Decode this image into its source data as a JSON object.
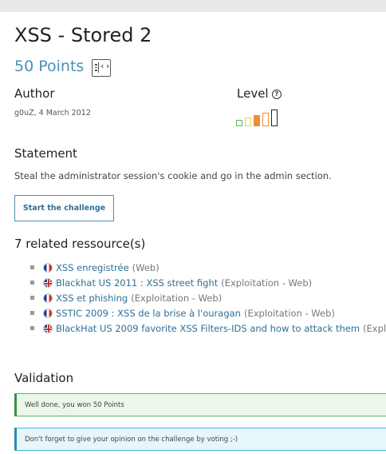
{
  "challenge": {
    "title": "XSS - Stored 2",
    "points": "50 Points",
    "points_icon": "code-window-icon"
  },
  "author": {
    "heading": "Author",
    "value": "g0uZ,  4 March 2012"
  },
  "level": {
    "heading": "Level",
    "help_icon": "question-circle-icon",
    "current_level": 3,
    "max_level": 5,
    "colors": [
      "#5cb85c",
      "#e2d74c",
      "#e8913a",
      "#e8913a",
      "#222222"
    ]
  },
  "statement": {
    "heading": "Statement",
    "text": "Steal the administrator session's cookie and go in the admin section."
  },
  "start_button": "Start the challenge",
  "resources": {
    "heading": "7 related ressource(s)",
    "items": [
      {
        "flag": "fr",
        "title": "XSS enregistrée",
        "category": "(Web)"
      },
      {
        "flag": "uk",
        "title": "Blackhat US 2011 : XSS street fight",
        "category": "(Exploitation - Web)"
      },
      {
        "flag": "fr",
        "title": "XSS et phishing",
        "category": "(Exploitation - Web)"
      },
      {
        "flag": "fr",
        "title": "SSTIC 2009 : XSS de la brise à l'ouragan",
        "category": "(Exploitation - Web)"
      },
      {
        "flag": "uk",
        "title": "BlackHat US 2009 favorite XSS Filters-IDS and how to attack them",
        "category": "(Exploita"
      }
    ]
  },
  "validation": {
    "heading": "Validation",
    "success_message": "Well done, you won 50 Points",
    "info_message": "Don't forget to give your opinion on the challenge by voting ;-)"
  }
}
